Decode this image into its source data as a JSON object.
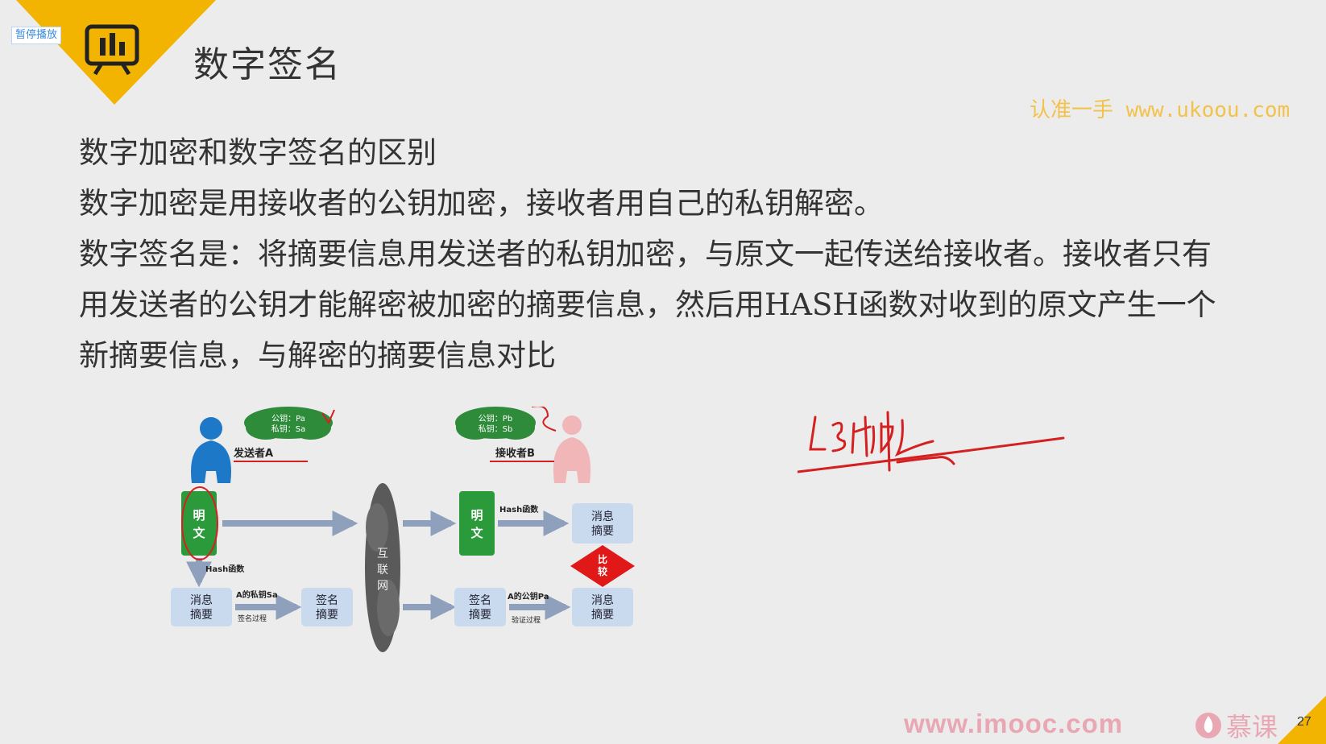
{
  "badge": {
    "pause_label": "暂停播放"
  },
  "title": "数字签名",
  "watermark_top": "认准一手 www.ukoou.com",
  "paragraphs": [
    "数字加密和数字签名的区别",
    "数字加密是用接收者的公钥加密，接收者用自己的私钥解密。",
    "数字签名是：将摘要信息用发送者的私钥加密，与原文一起传送给接收者。接收者只有用发送者的公钥才能解密被加密的摘要信息，然后用HASH函数对收到的原文产生一个新摘要信息，与解密的摘要信息对比"
  ],
  "diagram": {
    "sender_keys": [
      "公钥：Pa",
      "私钥：Sa"
    ],
    "sender_label": "发送者A",
    "receiver_keys": [
      "公钥：Pb",
      "私钥：Sb"
    ],
    "receiver_label": "接收者B",
    "plaintext": [
      "明",
      "文"
    ],
    "hash_func_left": "Hash函数",
    "hash_func_right": "Hash函数",
    "digest": [
      "消息",
      "摘要"
    ],
    "signed_digest": [
      "签名",
      "摘要"
    ],
    "private_key_label": "A的私钥Sa",
    "sign_process": "签名过程",
    "public_key_label": "A的公钥Pa",
    "verify_process": "验证过程",
    "internet": [
      "互",
      "联",
      "网"
    ],
    "compare": [
      "比",
      "较"
    ]
  },
  "footer": {
    "url": "www.imooc.com",
    "brand": "慕课",
    "page": "27"
  },
  "colors": {
    "accent_yellow": "#f2b400",
    "sender_blue": "#1e78c8",
    "receiver_pink": "#f0b6b8",
    "box_green": "#2a9a3a",
    "box_lightblue": "#c9d9ee",
    "compare_red": "#e01818",
    "annotation_red": "#d42020"
  }
}
